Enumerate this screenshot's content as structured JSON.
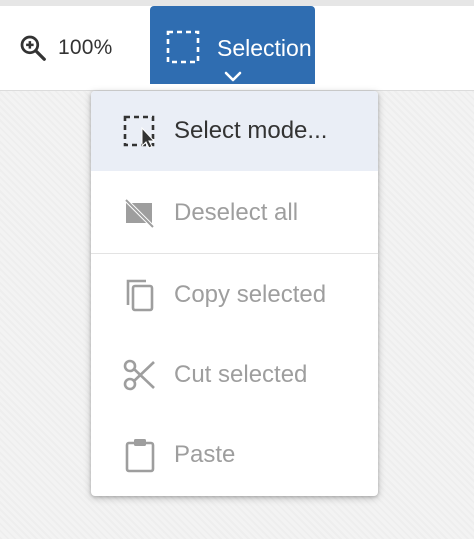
{
  "toolbar": {
    "zoom": {
      "icon": "zoom-in-icon",
      "value": "100%"
    },
    "selection_button": {
      "label": "Selection",
      "icon": "selection-dashed-icon",
      "chevron": "chevron-down-icon"
    }
  },
  "menu": {
    "items": [
      {
        "label": "Select mode...",
        "icon": "select-mode-icon",
        "state": "active"
      },
      {
        "label": "Deselect all",
        "icon": "deselect-all-icon",
        "state": "disabled"
      },
      {
        "label": "Copy selected",
        "icon": "copy-icon",
        "state": "disabled"
      },
      {
        "label": "Cut selected",
        "icon": "scissors-icon",
        "state": "disabled"
      },
      {
        "label": "Paste",
        "icon": "clipboard-icon",
        "state": "disabled"
      }
    ]
  },
  "colors": {
    "accent": "#2f6db1",
    "text_primary": "#333333",
    "text_disabled": "#9e9e9e",
    "active_item_bg": "#eaeef6"
  }
}
